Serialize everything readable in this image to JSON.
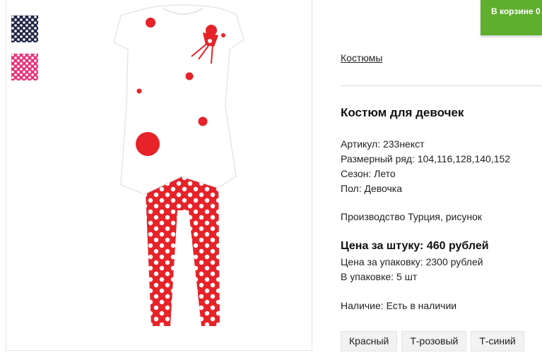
{
  "cart": {
    "label": "В корзине 0"
  },
  "breadcrumb": {
    "label": "Костюмы"
  },
  "product": {
    "title": "Костюм для девочек",
    "article": "Артикул: 233некст",
    "sizes": "Размерный ряд: 104,116,128,140,152",
    "season": "Сезон: Лето",
    "gender": "Пол: Девочка",
    "origin": "Производство Турция, рисунок",
    "unit_price": "Цена за штуку: 460 рублей",
    "pack_price": "Цена за упаковку: 2300 рублей",
    "pack_qty": "В упаковке: 5 шт",
    "availability": "Наличие: Есть в наличии"
  },
  "color_options": [
    "Красный",
    "Т-розовый",
    "Т-синий"
  ],
  "thumbnails": [
    {
      "icon": "navy-polka-dot-swatch",
      "color": "#1f2547"
    },
    {
      "icon": "pink-polka-dot-swatch",
      "color": "#e8327a"
    }
  ],
  "colors": {
    "accent_green": "#5fae2e",
    "dot_red": "#e52329"
  }
}
